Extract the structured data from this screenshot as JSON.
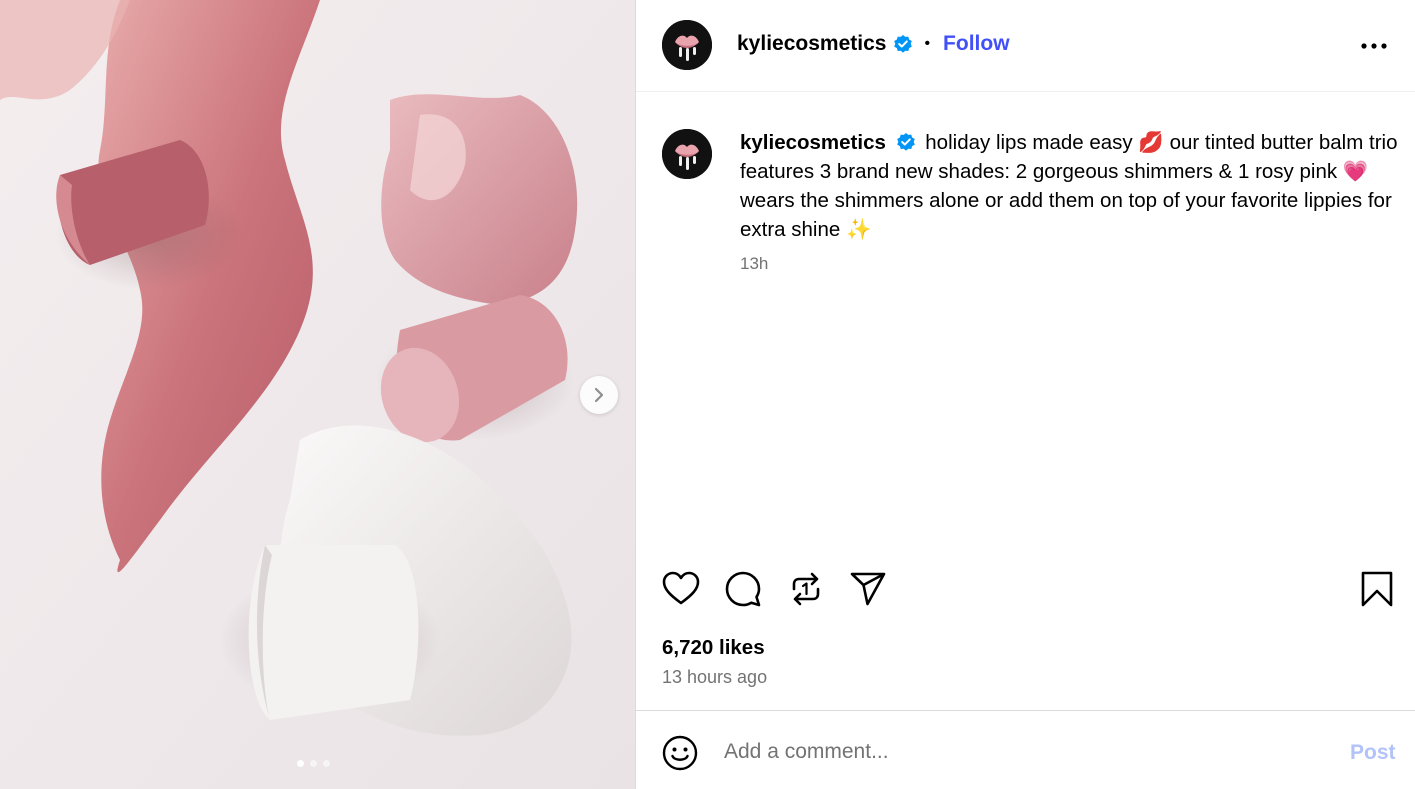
{
  "post": {
    "username": "kyliecosmetics",
    "follow_label": "Follow",
    "separator": "•",
    "caption_text": "holiday lips made easy 💋 our tinted butter balm trio features 3 brand new shades: 2 gorgeous shimmers & 1 rosy pink 💗 wears the shimmers alone or add them on top of your favorite lippies for extra shine ✨",
    "caption_time": "13h",
    "likes": "6,720 likes",
    "time_ago": "13 hours ago"
  },
  "comment": {
    "placeholder": "Add a comment...",
    "post_label": "Post"
  },
  "carousel": {
    "slide_count": 3,
    "active_index": 0
  },
  "icons": {
    "like": "heart-icon",
    "comment": "comment-icon",
    "repost": "repost-icon",
    "share": "share-icon",
    "save": "bookmark-icon",
    "more": "more-icon",
    "emoji": "emoji-icon",
    "next": "chevron-right-icon",
    "verified": "verified-badge-icon"
  },
  "colors": {
    "accent": "#4150f7",
    "verified": "#0095f6",
    "post_disabled": "#b2c3f9",
    "muted": "#737373"
  }
}
